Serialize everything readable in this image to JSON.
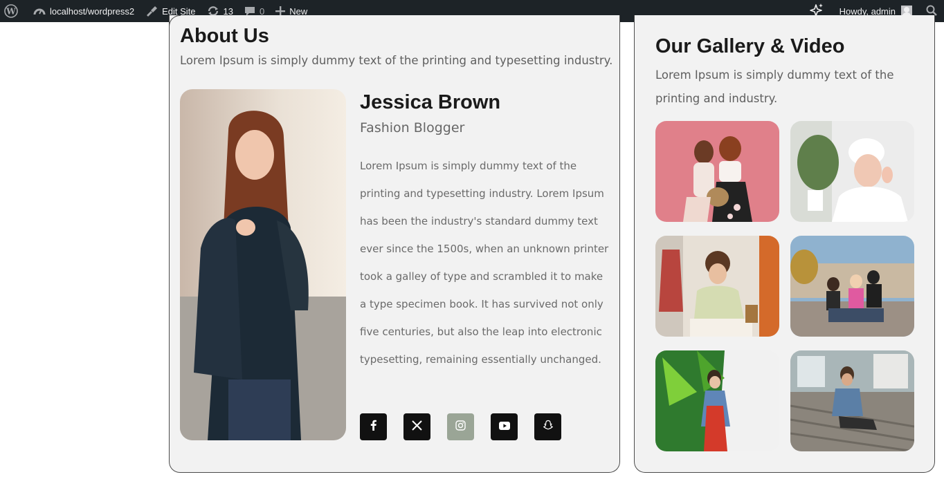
{
  "adminbar": {
    "site_label": "localhost/wordpress2",
    "edit_site_label": "Edit Site",
    "updates_count": "13",
    "comments_count": "0",
    "new_label": "New",
    "howdy_label": "Howdy, admin"
  },
  "about": {
    "title": "About Us",
    "subtitle": "Lorem Ipsum is simply dummy text of the printing and typesetting industry.",
    "name": "Jessica Brown",
    "role": "Fashion Blogger",
    "bio": "Lorem Ipsum is simply dummy text of the printing and typesetting industry. Lorem Ipsum has been the industry's standard dummy text ever since the 1500s, when an unknown printer took a galley of type and scrambled it to make a type specimen book. It has survived not only five centuries, but also the leap into electronic typesetting, remaining essentially unchanged.",
    "socials": [
      {
        "icon": "facebook-icon",
        "color": "#111111"
      },
      {
        "icon": "x-twitter-icon",
        "color": "#111111"
      },
      {
        "icon": "instagram-icon",
        "color": "#9aa596"
      },
      {
        "icon": "youtube-icon",
        "color": "#111111"
      },
      {
        "icon": "snapchat-icon",
        "color": "#111111"
      }
    ]
  },
  "gallery": {
    "title": "Our Gallery & Video",
    "subtitle": "Lorem Ipsum is simply dummy text of the printing and industry."
  },
  "colors": {
    "adminbar_bg": "#1d2327",
    "card_bg": "#f2f2f2",
    "instagram_active": "#9aa596"
  }
}
